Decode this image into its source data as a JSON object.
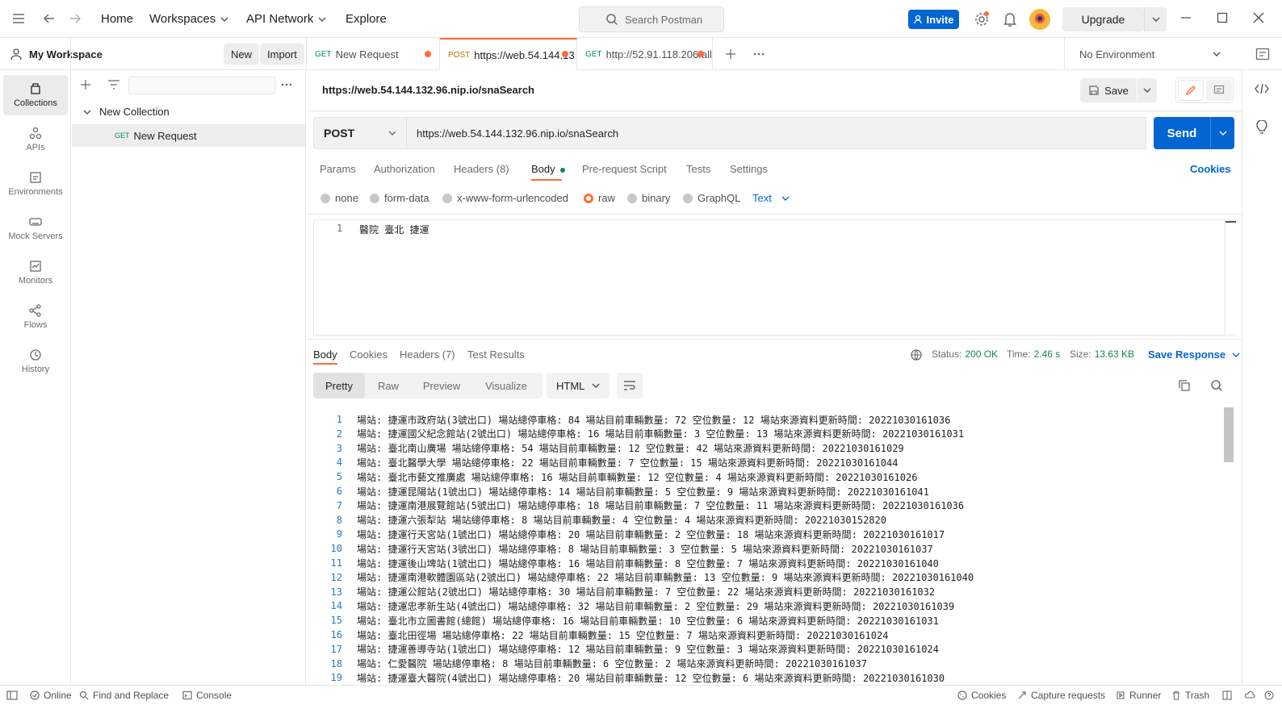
{
  "topbar": {
    "nav": [
      "Home",
      "Workspaces",
      "API Network",
      "Explore"
    ],
    "search_placeholder": "Search Postman",
    "invite": "Invite",
    "upgrade": "Upgrade"
  },
  "workspace": {
    "name": "My Workspace",
    "new_btn": "New",
    "import_btn": "Import"
  },
  "rail": [
    {
      "label": "Collections",
      "icon": "collections-icon"
    },
    {
      "label": "APIs",
      "icon": "apis-icon"
    },
    {
      "label": "Environments",
      "icon": "environments-icon"
    },
    {
      "label": "Mock Servers",
      "icon": "mock-servers-icon"
    },
    {
      "label": "Monitors",
      "icon": "monitors-icon"
    },
    {
      "label": "Flows",
      "icon": "flows-icon"
    },
    {
      "label": "History",
      "icon": "history-icon"
    }
  ],
  "sidebar": {
    "collection": "New Collection",
    "request_method": "GET",
    "request_name": "New Request"
  },
  "tabs": [
    {
      "method": "GET",
      "label": "New Request"
    },
    {
      "method": "POST",
      "label": "https://web.54.144.13"
    },
    {
      "method": "GET",
      "label": "http://52.91.118.206/all"
    }
  ],
  "environment": "No Environment",
  "request": {
    "title": "https://web.54.144.132.96.nip.io/snaSearch",
    "save": "Save",
    "method": "POST",
    "url": "https://web.54.144.132.96.nip.io/snaSearch",
    "send": "Send",
    "tabs": [
      "Params",
      "Authorization",
      "Headers (8)",
      "Body",
      "Pre-request Script",
      "Tests",
      "Settings"
    ],
    "cookies": "Cookies",
    "body_types": [
      "none",
      "form-data",
      "x-www-form-urlencoded",
      "raw",
      "binary",
      "GraphQL"
    ],
    "body_format": "Text",
    "body_line_no": "1",
    "body_text": "醫院 臺北 捷運"
  },
  "response": {
    "tabs": [
      "Body",
      "Cookies",
      "Headers (7)",
      "Test Results"
    ],
    "status_label": "Status:",
    "status": "200 OK",
    "time_label": "Time:",
    "time": "2.46 s",
    "size_label": "Size:",
    "size": "13.63 KB",
    "save_response": "Save Response",
    "views": [
      "Pretty",
      "Raw",
      "Preview",
      "Visualize"
    ],
    "format": "HTML",
    "lines": [
      "場站: 捷運市政府站(3號出口) 場站總停車格: 84 場站目前車輛數量: 72 空位數量: 12 場站來源資料更新時間: 20221030161036",
      "場站: 捷運國父紀念館站(2號出口) 場站總停車格: 16 場站目前車輛數量: 3 空位數量: 13 場站來源資料更新時間: 20221030161031",
      "場站: 臺北南山廣場 場站總停車格: 54 場站目前車輛數量: 12 空位數量: 42 場站來源資料更新時間: 20221030161029",
      "場站: 臺北醫學大學 場站總停車格: 22 場站目前車輛數量: 7 空位數量: 15 場站來源資料更新時間: 20221030161044",
      "場站: 臺北市藝文推廣處 場站總停車格: 16 場站目前車輛數量: 12 空位數量: 4 場站來源資料更新時間: 20221030161026",
      "場站: 捷運昆陽站(1號出口) 場站總停車格: 14 場站目前車輛數量: 5 空位數量: 9 場站來源資料更新時間: 20221030161041",
      "場站: 捷運南港展覽館站(5號出口) 場站總停車格: 18 場站目前車輛數量: 7 空位數量: 11 場站來源資料更新時間: 20221030161036",
      "場站: 捷運六張犁站 場站總停車格: 8 場站目前車輛數量: 4 空位數量: 4 場站來源資料更新時間: 20221030152820",
      "場站: 捷運行天宮站(1號出口) 場站總停車格: 20 場站目前車輛數量: 2 空位數量: 18 場站來源資料更新時間: 20221030161017",
      "場站: 捷運行天宮站(3號出口) 場站總停車格: 8 場站目前車輛數量: 3 空位數量: 5 場站來源資料更新時間: 20221030161037",
      "場站: 捷運後山埤站(1號出口) 場站總停車格: 16 場站目前車輛數量: 8 空位數量: 7 場站來源資料更新時間: 20221030161040",
      "場站: 捷運南港軟體園區站(2號出口) 場站總停車格: 22 場站目前車輛數量: 13 空位數量: 9 場站來源資料更新時間: 20221030161040",
      "場站: 捷運公館站(2號出口) 場站總停車格: 30 場站目前車輛數量: 7 空位數量: 22 場站來源資料更新時間: 20221030161032",
      "場站: 捷運忠孝新生站(4號出口) 場站總停車格: 32 場站目前車輛數量: 2 空位數量: 29 場站來源資料更新時間: 20221030161039",
      "場站: 臺北市立圖書館(總館) 場站總停車格: 16 場站目前車輛數量: 10 空位數量: 6 場站來源資料更新時間: 20221030161031",
      "場站: 臺北田徑場 場站總停車格: 22 場站目前車輛數量: 15 空位數量: 7 場站來源資料更新時間: 20221030161024",
      "場站: 捷運善導寺站(1號出口) 場站總停車格: 12 場站目前車輛數量: 9 空位數量: 3 場站來源資料更新時間: 20221030161024",
      "場站: 仁愛醫院 場站總停車格: 8 場站目前車輛數量: 6 空位數量: 2 場站來源資料更新時間: 20221030161037",
      "場站: 捷運臺大醫院(4號出口) 場站總停車格: 20 場站目前車輛數量: 12 空位數量: 6 場站來源資料更新時間: 20221030161030"
    ]
  },
  "statusbar": {
    "online": "Online",
    "find_replace": "Find and Replace",
    "console": "Console",
    "cookies": "Cookies",
    "capture": "Capture requests",
    "runner": "Runner",
    "trash": "Trash"
  },
  "colors": {
    "accent": "#ff6c37",
    "primary": "#0265d2",
    "status_ok": "#0f8a4f"
  }
}
